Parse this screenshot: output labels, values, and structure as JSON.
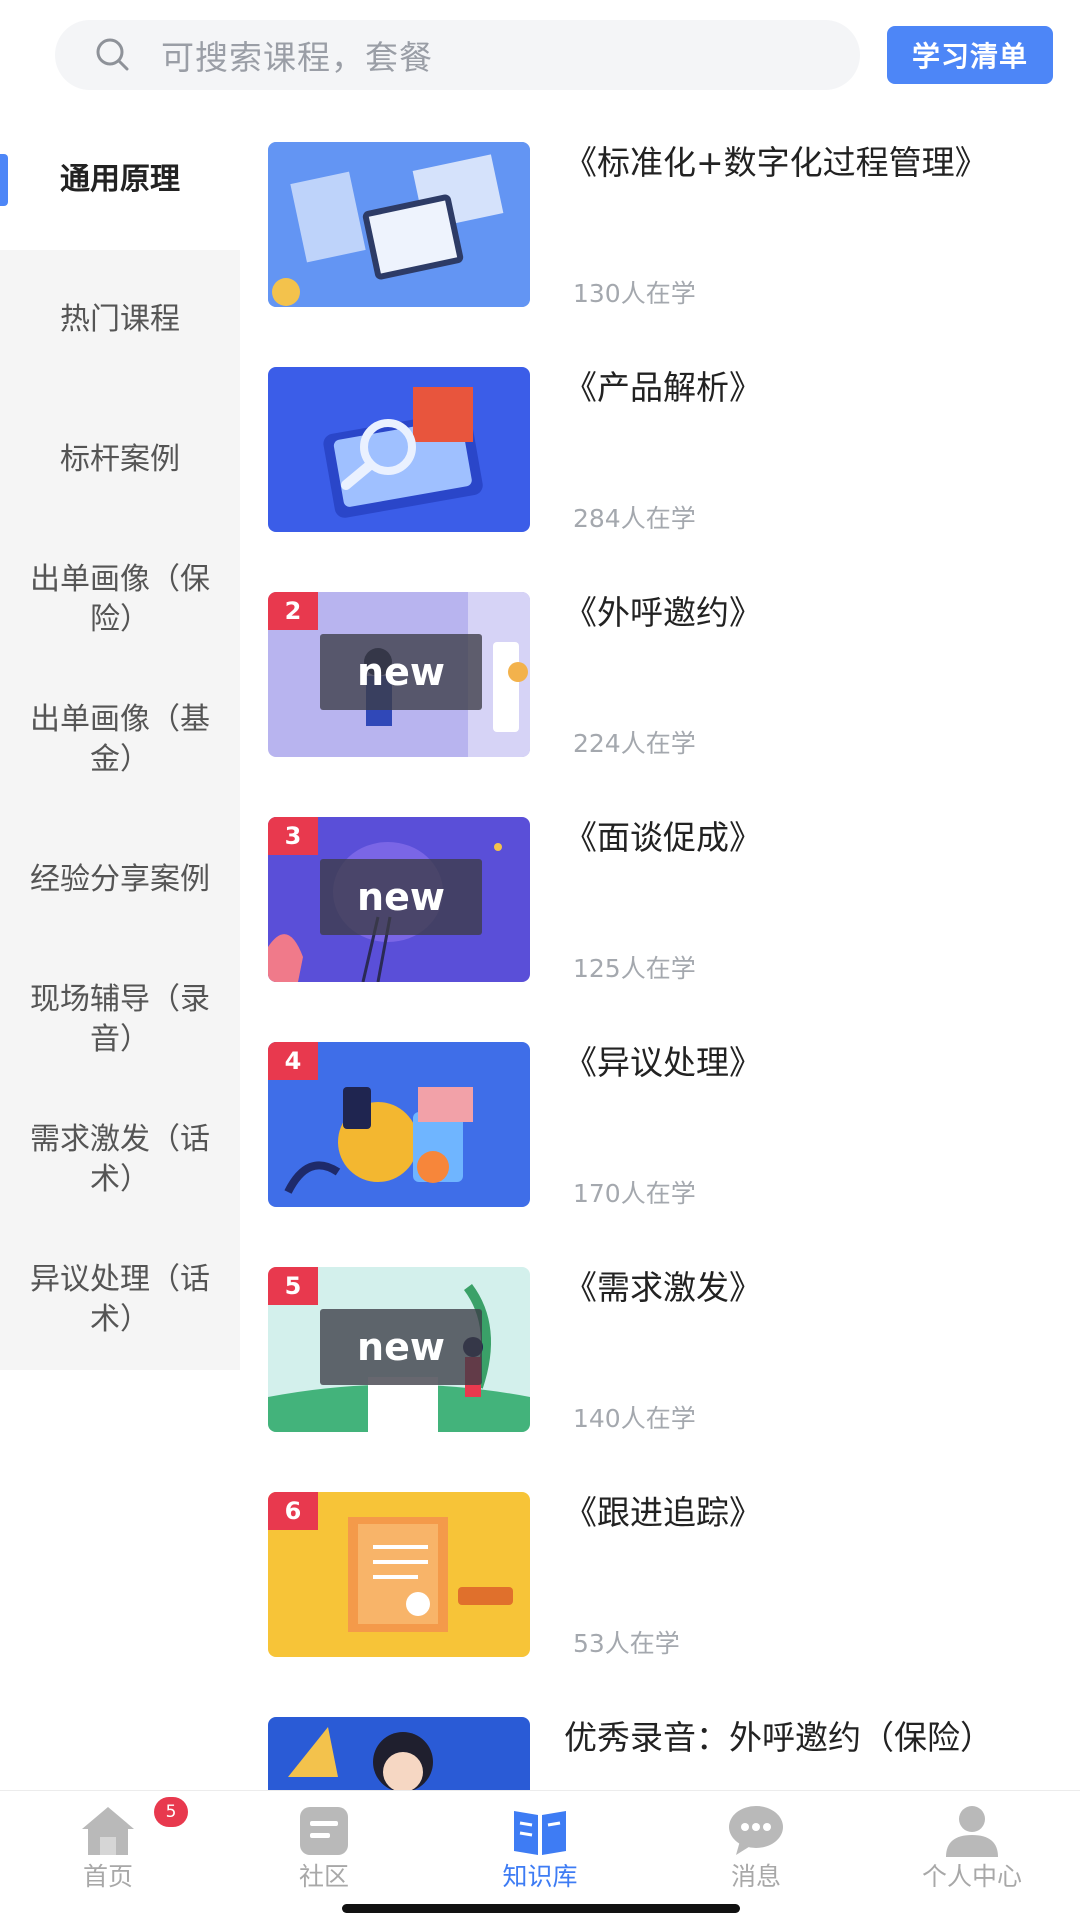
{
  "search": {
    "placeholder": "可搜索课程，套餐",
    "icon": "search-icon"
  },
  "study_list_button": "学习清单",
  "sidebar": {
    "items": [
      {
        "label": "通用原理",
        "active": true
      },
      {
        "label": "热门课程",
        "active": false
      },
      {
        "label": "标杆案例",
        "active": false
      },
      {
        "label": "出单画像（保险）",
        "active": false
      },
      {
        "label": "出单画像（基金）",
        "active": false
      },
      {
        "label": "经验分享案例",
        "active": false
      },
      {
        "label": "现场辅导（录音）",
        "active": false
      },
      {
        "label": "需求激发（话术）",
        "active": false
      },
      {
        "label": "异议处理（话术）",
        "active": false
      }
    ]
  },
  "courses": [
    {
      "title": "《标准化+数字化过程管理》",
      "learners": "130人在学",
      "badge": "",
      "new_tag": ""
    },
    {
      "title": "《产品解析》",
      "learners": "284人在学",
      "badge": "",
      "new_tag": ""
    },
    {
      "title": "《外呼邀约》",
      "learners": "224人在学",
      "badge": "2",
      "new_tag": "new"
    },
    {
      "title": "《面谈促成》",
      "learners": "125人在学",
      "badge": "3",
      "new_tag": "new"
    },
    {
      "title": "《异议处理》",
      "learners": "170人在学",
      "badge": "4",
      "new_tag": ""
    },
    {
      "title": "《需求激发》",
      "learners": "140人在学",
      "badge": "5",
      "new_tag": "new"
    },
    {
      "title": "《跟进追踪》",
      "learners": "53人在学",
      "badge": "6",
      "new_tag": ""
    },
    {
      "title": "优秀录音：外呼邀约（保险）",
      "learners": "",
      "badge": "",
      "new_tag": ""
    }
  ],
  "tabbar": {
    "tabs": [
      {
        "label": "首页",
        "icon": "home-icon",
        "badge": "5",
        "active": false
      },
      {
        "label": "社区",
        "icon": "community-icon",
        "active": false
      },
      {
        "label": "知识库",
        "icon": "book-icon",
        "active": true
      },
      {
        "label": "消息",
        "icon": "chat-bubble-icon",
        "active": false
      },
      {
        "label": "个人中心",
        "icon": "person-icon",
        "active": false
      }
    ]
  },
  "colors": {
    "accent": "#4d86f7",
    "active_tab": "#3e7cf4",
    "badge": "#e8394e"
  }
}
